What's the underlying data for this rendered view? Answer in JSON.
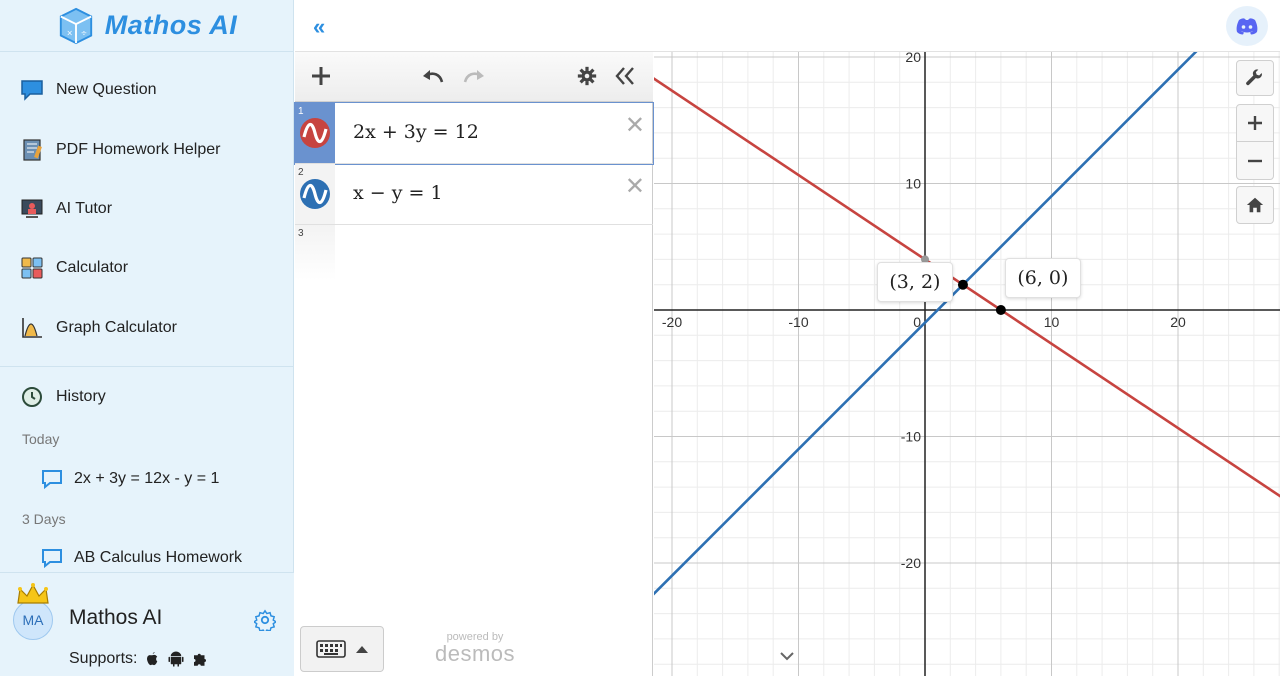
{
  "brand": {
    "name": "Mathos AI"
  },
  "nav": [
    {
      "label": "New Question",
      "icon": "chat-bubble-icon"
    },
    {
      "label": "PDF Homework Helper",
      "icon": "notebook-icon"
    },
    {
      "label": "AI Tutor",
      "icon": "tutor-icon"
    },
    {
      "label": "Calculator",
      "icon": "calculator-icon"
    },
    {
      "label": "Graph Calculator",
      "icon": "graph-icon"
    }
  ],
  "history": {
    "label": "History",
    "groups": [
      {
        "heading": "Today",
        "items": [
          "2x + 3y = 12x - y = 1"
        ]
      },
      {
        "heading": "3 Days",
        "items": [
          "AB Calculus Homework"
        ]
      }
    ]
  },
  "user": {
    "initials": "MA",
    "name": "Mathos AI",
    "supports_label": "Supports:"
  },
  "expressions": [
    {
      "num": "1",
      "latex": "2x + 3y = 12",
      "color": "#c74440"
    },
    {
      "num": "2",
      "latex": "x − y = 1",
      "color": "#2d70b3"
    },
    {
      "num": "3",
      "latex": ""
    }
  ],
  "powered": {
    "line1": "powered by",
    "line2": "desmos"
  },
  "graph": {
    "x_ticks": [
      "-20",
      "-10",
      "0",
      "10",
      "20"
    ],
    "y_ticks": [
      "20",
      "10",
      "-10",
      "-20"
    ],
    "points": [
      {
        "label": "(3, 2)",
        "x": 3,
        "y": 2
      },
      {
        "label": "(6, 0)",
        "x": 6,
        "y": 0
      }
    ],
    "colors": {
      "line1": "#c74440",
      "line2": "#2d70b3"
    }
  }
}
